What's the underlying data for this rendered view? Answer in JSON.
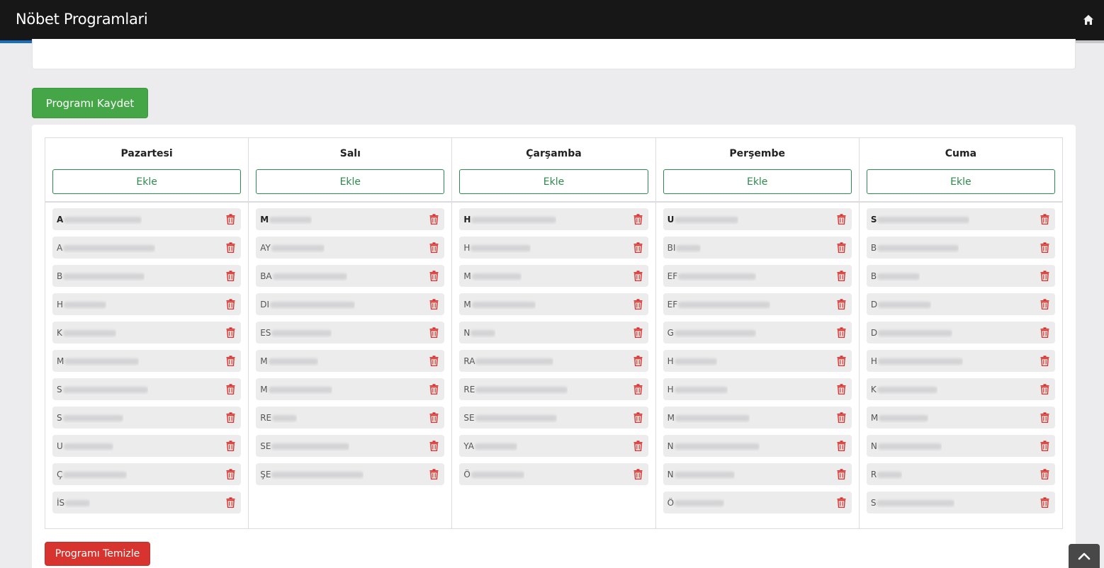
{
  "app": {
    "title": "Nöbet Programlari",
    "progress_fraction": 0.156
  },
  "actions": {
    "save_label": "Programı Kaydet",
    "clear_label": "Programı Temizle",
    "add_label": "Ekle"
  },
  "icons": {
    "home": "home-icon",
    "trash": "trash-icon",
    "scroll_top": "chevron-up-icon"
  },
  "colors": {
    "save": "#44a647",
    "clear": "#d8342f",
    "add_outline": "#2d8a4e",
    "trash": "#d9342f",
    "header_bg": "#171717",
    "progress": "#1a6fbd"
  },
  "days": [
    {
      "name": "Pazartesi",
      "entries": [
        "A",
        "A",
        "B",
        "H",
        "K",
        "M",
        "S",
        "S",
        "U",
        "Ç",
        "İS"
      ]
    },
    {
      "name": "Salı",
      "entries": [
        "M",
        "AY",
        "BA",
        "DI",
        "ES",
        "M",
        "M",
        "RE",
        "SE",
        "ŞE"
      ]
    },
    {
      "name": "Çarşamba",
      "entries": [
        "H",
        "H",
        "M",
        "M",
        "N",
        "RA",
        "RE",
        "SE",
        "YA",
        "Ö"
      ]
    },
    {
      "name": "Perşembe",
      "entries": [
        "U",
        "BI",
        "EF",
        "EF",
        "G",
        "H",
        "H",
        "M",
        "N",
        "N",
        "Ö"
      ]
    },
    {
      "name": "Cuma",
      "entries": [
        "S",
        "B",
        "B",
        "D",
        "D",
        "H",
        "K",
        "M",
        "N",
        "R",
        "S"
      ]
    }
  ]
}
